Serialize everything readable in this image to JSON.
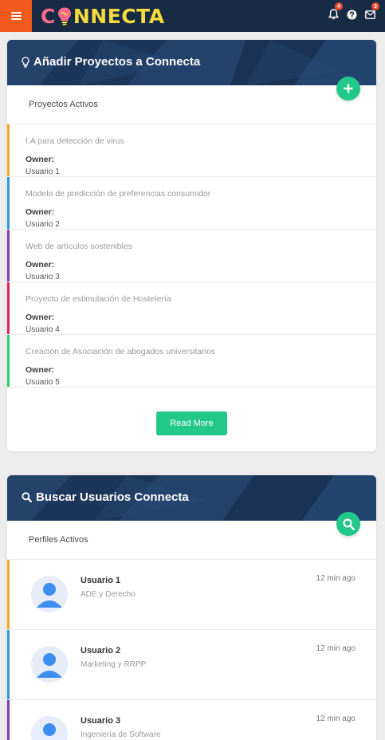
{
  "app": {
    "logo_text_left": "C",
    "logo_text_right": "NNECTA"
  },
  "topbar": {
    "notifications_count": "4",
    "messages_count": "3"
  },
  "projects_card": {
    "title": "Añadir Proyectos a Connecta",
    "subtitle": "Proyectos Activos",
    "owner_label": "Owner:",
    "items": [
      {
        "title": "I.A para detección de virus",
        "owner": "Usuario 1",
        "color": "#f5a623"
      },
      {
        "title": "Modelo de predicción de preferencias consumidor",
        "owner": "Usuario 2",
        "color": "#2d9cdb"
      },
      {
        "title": "Web de artículos sostenibles",
        "owner": "Usuario 3",
        "color": "#7b3fb2"
      },
      {
        "title": "Proyecto de estimulación de Hostelería",
        "owner": "Usuario 4",
        "color": "#e0245e"
      },
      {
        "title": "Creación de Asociación de abogados universitarios",
        "owner": "Usuario 5",
        "color": "#2ecc71"
      }
    ],
    "read_more_label": "Read More"
  },
  "users_card": {
    "title": "Buscar Usuarios Connecta",
    "subtitle": "Perfiles Activos",
    "items": [
      {
        "name": "Usuario 1",
        "role": "ADE y Derecho",
        "time": "12 min ago",
        "color": "#f5a623"
      },
      {
        "name": "Usuario 2",
        "role": "Marketing y RRPP",
        "time": "12 min ago",
        "color": "#2d9cdb"
      },
      {
        "name": "Usuario 3",
        "role": "Ingeniería de Software",
        "time": "12 min ago",
        "color": "#7b3fb2"
      }
    ]
  },
  "colors": {
    "topbar": "#182b45",
    "menu": "#f05a1a",
    "accent_green": "#22c78a",
    "header": "#1f3a5c"
  },
  "icons": {
    "menu": "hamburger-icon",
    "notifications": "bell-icon",
    "help": "question-circle-icon",
    "messages": "envelope-icon",
    "projects_header": "lightbulb-icon",
    "users_header": "search-icon",
    "add": "plus-icon",
    "search_fab": "search-icon",
    "avatar": "user-avatar-icon"
  }
}
